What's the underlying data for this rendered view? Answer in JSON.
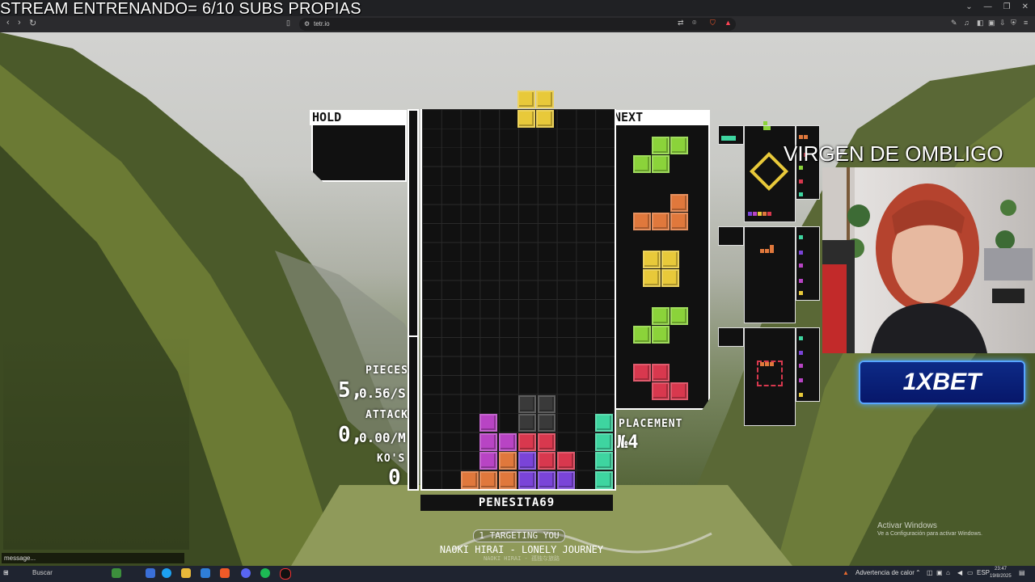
{
  "stream_title": "STREAM ENTRENANDO= 6/10 SUBS PROPIAS",
  "browser": {
    "url": "tetr.io"
  },
  "game": {
    "hold_label": "HOLD",
    "next_label": "NEXT",
    "stats": {
      "pieces_label": "PIECES",
      "pieces_value": "5,",
      "pieces_rate": "0.56/S",
      "attack_label": "ATTACK",
      "attack_value": "0,",
      "attack_rate": "0.00/M",
      "kos_label": "KO'S",
      "kos_value": "0"
    },
    "placement_label": "PLACEMENT",
    "placement_value": "№4",
    "player_name": "PENESITA69",
    "targeting": "1 TARGETING YOU",
    "music_title": "NAOKI HIRAI - LONELY JOURNEY",
    "music_subtitle": "NAOKI HIRAI - 孤独な旅路",
    "colors": {
      "yellow": "#e8c93a",
      "green": "#8bd33a",
      "orange": "#e0783c",
      "red": "#d8384e",
      "purple": "#b844c4",
      "violet": "#7a44d8",
      "teal": "#3ed5a0",
      "garbage": "#3a3a3a"
    }
  },
  "webcam": {
    "title": "VIRGEN DE OMBLIGO"
  },
  "sponsor": "1XBET",
  "watermark": {
    "line1": "Activar Windows",
    "line2": "Ve a Configuración para activar Windows."
  },
  "chat": {
    "placeholder": "message..."
  },
  "taskbar": {
    "search": "Buscar",
    "heat_warning": "Advertencia de calor",
    "language": "ESP",
    "time": "23:47",
    "date": "19/8/2025"
  }
}
